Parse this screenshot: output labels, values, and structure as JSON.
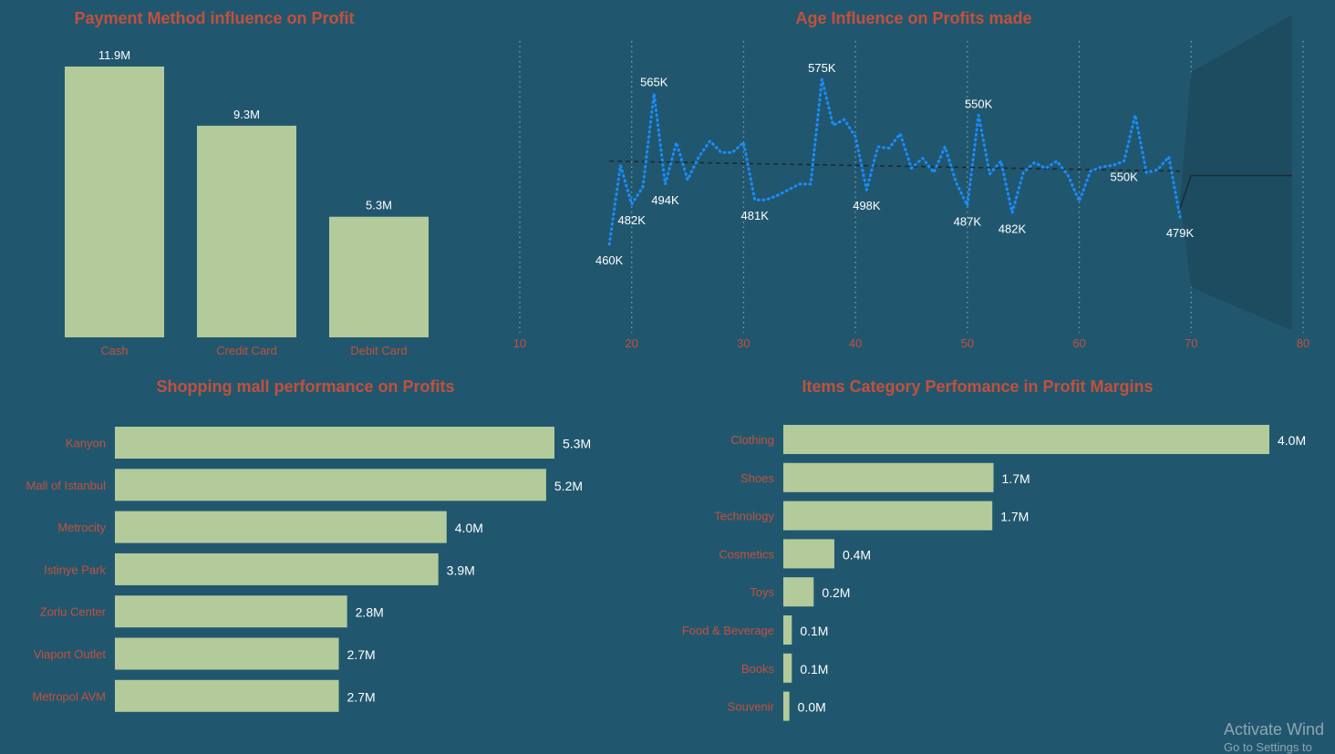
{
  "colors": {
    "background": "#21576e",
    "bar": "#b3cb9a",
    "title": "#c3503d",
    "category_label": "#c3503d",
    "value_label": "#ffffff",
    "line": "#1a8cff",
    "trend": "#1c2a33",
    "forecast_band": "#1d4b60"
  },
  "watermark": {
    "line1": "Activate Wind",
    "line2": "Go to Settings to"
  },
  "chart_data": [
    {
      "type": "bar",
      "orientation": "vertical",
      "title": "Payment Method influence on Profit",
      "categories": [
        "Cash",
        "Credit Card",
        "Debit Card"
      ],
      "values": [
        11.9,
        9.3,
        5.3
      ],
      "value_labels": [
        "11.9M",
        "9.3M",
        "5.3M"
      ],
      "ylim": [
        0,
        11.9
      ],
      "grid": false
    },
    {
      "type": "line",
      "title": "Age Influence on Profits made",
      "x": [
        18,
        19,
        20,
        21,
        22,
        23,
        24,
        25,
        26,
        27,
        28,
        29,
        30,
        31,
        32,
        33,
        34,
        35,
        36,
        37,
        38,
        39,
        40,
        41,
        42,
        43,
        44,
        45,
        46,
        47,
        48,
        49,
        50,
        51,
        52,
        53,
        54,
        55,
        56,
        57,
        58,
        59,
        60,
        61,
        62,
        63,
        64,
        65,
        66,
        67,
        68,
        69
      ],
      "y": [
        460,
        515,
        488,
        500,
        565,
        502,
        531,
        505,
        521,
        532,
        524,
        524,
        531,
        491,
        491,
        494,
        498,
        502,
        502,
        575,
        543,
        547,
        535,
        498,
        528,
        527,
        537,
        513,
        520,
        510,
        528,
        503,
        487,
        550,
        509,
        518,
        482,
        510,
        517,
        513,
        518,
        508,
        490,
        511,
        514,
        515,
        518,
        550,
        510,
        512,
        521,
        479
      ],
      "point_labels": [
        {
          "x": 18,
          "text": "460K"
        },
        {
          "x": 20,
          "text": "482K"
        },
        {
          "x": 22,
          "text": "565K"
        },
        {
          "x": 23,
          "text": "494K"
        },
        {
          "x": 31,
          "text": "481K"
        },
        {
          "x": 37,
          "text": "575K"
        },
        {
          "x": 41,
          "text": "498K"
        },
        {
          "x": 50,
          "text": "487K"
        },
        {
          "x": 51,
          "text": "550K"
        },
        {
          "x": 54,
          "text": "482K"
        },
        {
          "x": 64,
          "text": "550K"
        },
        {
          "x": 69,
          "text": "479K"
        }
      ],
      "trend": {
        "x": [
          18,
          69
        ],
        "y": [
          518,
          511
        ]
      },
      "forecast": {
        "x": [
          69,
          70,
          79
        ],
        "y": [
          485,
          508,
          508
        ],
        "band_lower": [
          490,
          430,
          400
        ],
        "band_upper": [
          490,
          580,
          620
        ]
      },
      "xlim": [
        10,
        80
      ],
      "xticks": [
        10,
        20,
        30,
        40,
        50,
        60,
        70,
        80
      ],
      "grid": "vertical dotted"
    },
    {
      "type": "bar",
      "orientation": "horizontal",
      "title": "Shopping mall performance on Profits",
      "categories": [
        "Kanyon",
        "Mall of Istanbul",
        "Metrocity",
        "Istinye Park",
        "Zorlu Center",
        "Viaport Outlet",
        "Metropol AVM"
      ],
      "values": [
        5.3,
        5.2,
        4.0,
        3.9,
        2.8,
        2.7,
        2.7
      ],
      "value_labels": [
        "5.3M",
        "5.2M",
        "4.0M",
        "3.9M",
        "2.8M",
        "2.7M",
        "2.7M"
      ],
      "xlim": [
        0,
        5.3
      ]
    },
    {
      "type": "bar",
      "orientation": "horizontal",
      "title": "Items Category Perfomance in Profit Margins",
      "categories": [
        "Clothing",
        "Shoes",
        "Technology",
        "Cosmetics",
        "Toys",
        "Food & Beverage",
        "Books",
        "Souvenir"
      ],
      "values": [
        4.0,
        1.73,
        1.72,
        0.42,
        0.25,
        0.07,
        0.07,
        0.05
      ],
      "value_labels": [
        "4.0M",
        "1.7M",
        "1.7M",
        "0.4M",
        "0.2M",
        "0.1M",
        "0.1M",
        "0.0M"
      ],
      "xlim": [
        0,
        4.0
      ]
    }
  ]
}
